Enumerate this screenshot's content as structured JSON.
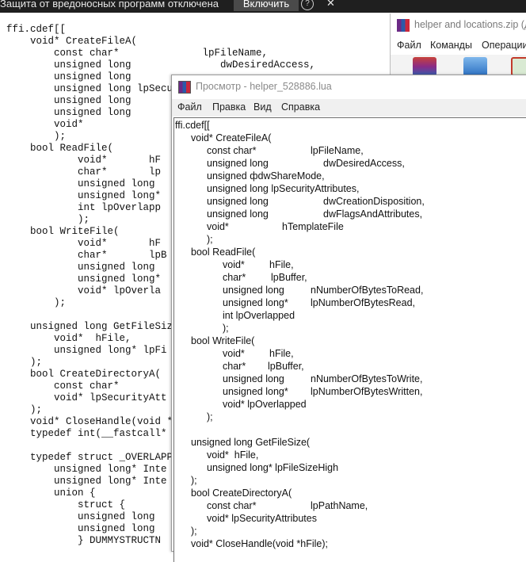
{
  "notification": {
    "message": "Защита от вредоносных программ отключена",
    "enable_button": "Включить",
    "help_icon": "?",
    "close_icon": "✕"
  },
  "background_code": "ffi.cdef[[\n    void* CreateFileA(\n        const char*              lpFileName,\n        unsigned long               dwDesiredAccess,\n        unsigned long\n        unsigned long lpSecu\n        unsigned long\n        unsigned long\n        void*\n        );\n    bool ReadFile(\n            void*       hF\n            char*       lp\n            unsigned long\n            unsigned long*\n            int lpOverlapp\n            );\n    bool WriteFile(\n            void*       hF\n            char*       lpB\n            unsigned long\n            unsigned long*\n            void* lpOverla\n        );\n\n    unsigned long GetFileSiz\n        void*  hFile,\n        unsigned long* lpFi\n    );\n    bool CreateDirectoryA(\n        const char*\n        void* lpSecurityAtt\n    );\n    void* CloseHandle(void *\n    typedef int(__fastcall*\n\n    typedef struct _OVERLAPP\n        unsigned long* Inte\n        unsigned long* Inte\n        union {\n            struct {\n            unsigned long\n            unsigned long\n            } DUMMYSTRUCTN",
  "rar_window": {
    "title": "helper and locations.zip (дн",
    "menu": [
      "Файл",
      "Команды",
      "Операции"
    ]
  },
  "viewer": {
    "title": "Просмотр - helper_528886.lua",
    "menu": [
      "Файл",
      "Правка",
      "Вид",
      "Справка"
    ],
    "lines": [
      "ffi.cdef[[",
      "void* CreateFileA(",
      "const char*",
      "lpFileName,",
      "unsigned long",
      "dwDesiredAccess,",
      "unsigned фdwShareMode,",
      "unsigned long lpSecurityAttributes,",
      "unsigned long",
      "dwCreationDisposition,",
      "unsigned long",
      "dwFlagsAndAttributes,",
      "void*",
      "hTemplateFile",
      ");",
      "bool ReadFile(",
      "void*",
      "hFile,",
      "char*",
      "lpBuffer,",
      "unsigned long",
      "nNumberOfBytesToRead,",
      "unsigned long*",
      "lpNumberOfBytesRead,",
      "int lpOverlapped",
      ");",
      "bool WriteFile(",
      "void*",
      "hFile,",
      "char*",
      "lpBuffer,",
      "unsigned long",
      "nNumberOfBytesToWrite,",
      "unsigned long*",
      "lpNumberOfBytesWritten,",
      "void* lpOverlapped",
      ");",
      "unsigned long GetFileSize(",
      "void*  hFile,",
      "unsigned long* lpFileSizeHigh",
      ");",
      "bool CreateDirectoryA(",
      "const char*",
      "lpPathName,",
      "void* lpSecurityAttributes",
      ");",
      "void* CloseHandle(void *hFile);"
    ]
  }
}
